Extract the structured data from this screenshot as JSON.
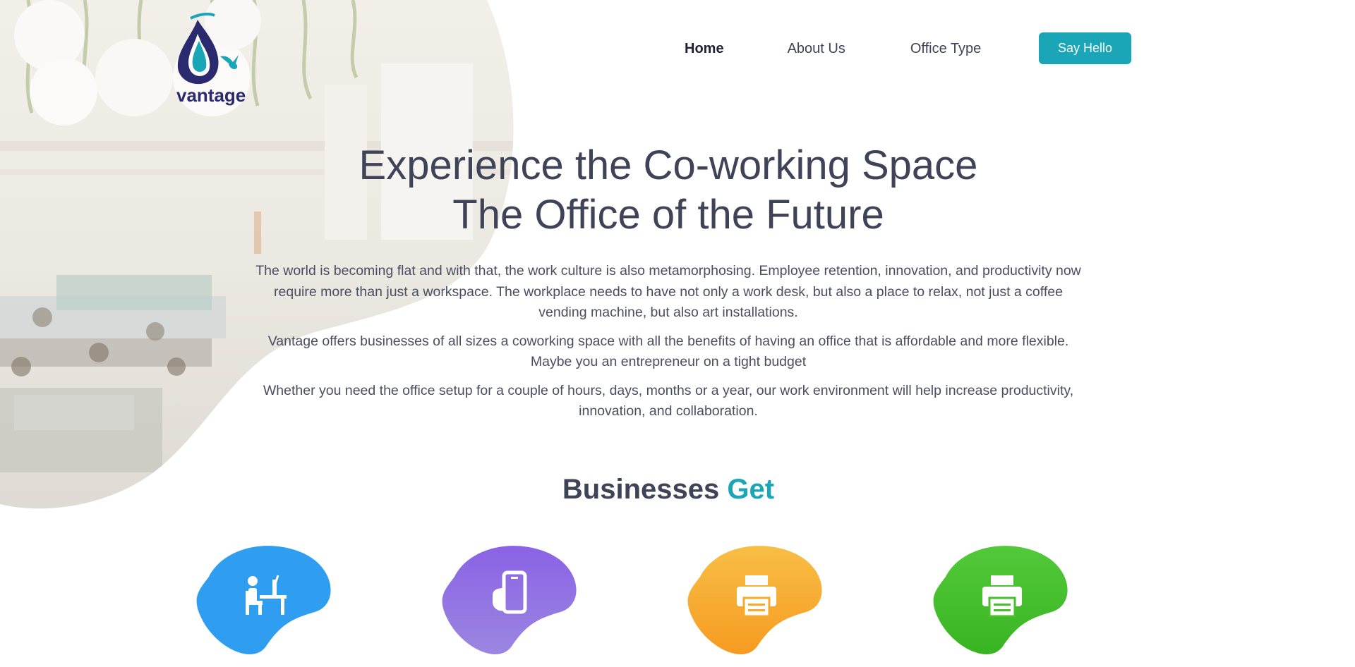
{
  "brand": {
    "name": "vantage"
  },
  "nav": {
    "items": [
      {
        "label": "Home"
      },
      {
        "label": "About Us"
      },
      {
        "label": "Office Type"
      }
    ],
    "cta_label": "Say Hello"
  },
  "hero": {
    "title_line1": "Experience the Co-working Space",
    "title_line2": "The Office of the Future",
    "paragraphs": [
      "The world is becoming flat and with that, the work culture is also metamorphosing. Employee retention, innovation, and productivity now require more than just a workspace. The workplace needs to have not only a work desk, but also a place to relax, not just a coffee vending machine, but also art installations.",
      "Vantage offers businesses of all sizes a coworking space with all the benefits of having an office that is affordable and more flexible. Maybe you an entrepreneur on a tight budget",
      "Whether you need the office setup for a couple of hours, days, months or a year, our work environment will help increase productivity, innovation, and collaboration."
    ]
  },
  "section": {
    "title_main": "Businesses",
    "title_accent": "Get"
  },
  "features": [
    {
      "icon": "desk-worker-icon",
      "color": "#2f9df0"
    },
    {
      "icon": "mobile-phone-icon",
      "color": "#8b6fe0"
    },
    {
      "icon": "printer-icon",
      "color": "#f7a928"
    },
    {
      "icon": "printer-icon",
      "color": "#46c02a"
    }
  ],
  "colors": {
    "accent": "#1aa6b7",
    "text": "#3e4357",
    "logo_navy": "#2b2a6e"
  }
}
